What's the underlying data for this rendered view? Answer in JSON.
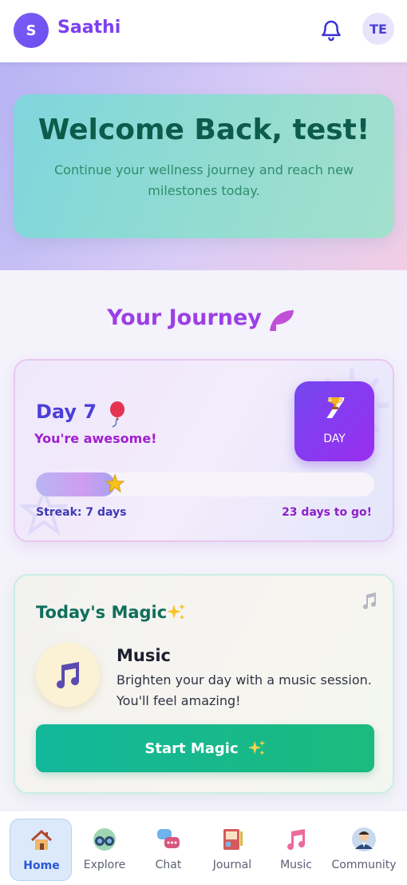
{
  "header": {
    "logo_letter": "S",
    "app_name": "Saathi",
    "avatar_initials": "TE"
  },
  "hero": {
    "title": "Welcome Back, test!",
    "subtitle": "Continue your wellness journey and reach new milestones today."
  },
  "journey": {
    "section_title": "Your Journey",
    "day_label": "Day 7",
    "message": "You're awesome!",
    "badge_number": "7",
    "badge_label": "DAY",
    "progress_fraction": 0.233,
    "streak_text": "Streak: 7 days",
    "remaining_text": "23 days to go!"
  },
  "magic": {
    "title": "Today's Magic",
    "activity_title": "Music",
    "activity_desc": "Brighten your day with a music session. You'll feel amazing!",
    "button_label": "Start Magic"
  },
  "nav": {
    "items": [
      {
        "label": "Home",
        "icon": "home-icon",
        "active": true
      },
      {
        "label": "Explore",
        "icon": "binoculars-icon",
        "active": false
      },
      {
        "label": "Chat",
        "icon": "chat-bubbles-icon",
        "active": false
      },
      {
        "label": "Journal",
        "icon": "journal-icon",
        "active": false
      },
      {
        "label": "Music",
        "icon": "music-note-icon",
        "active": false
      },
      {
        "label": "Community",
        "icon": "person-icon",
        "active": false
      }
    ]
  },
  "colors": {
    "brand": "#7b3ff2",
    "accent_green": "#13b79a",
    "badge_purple": "#7447f0"
  }
}
